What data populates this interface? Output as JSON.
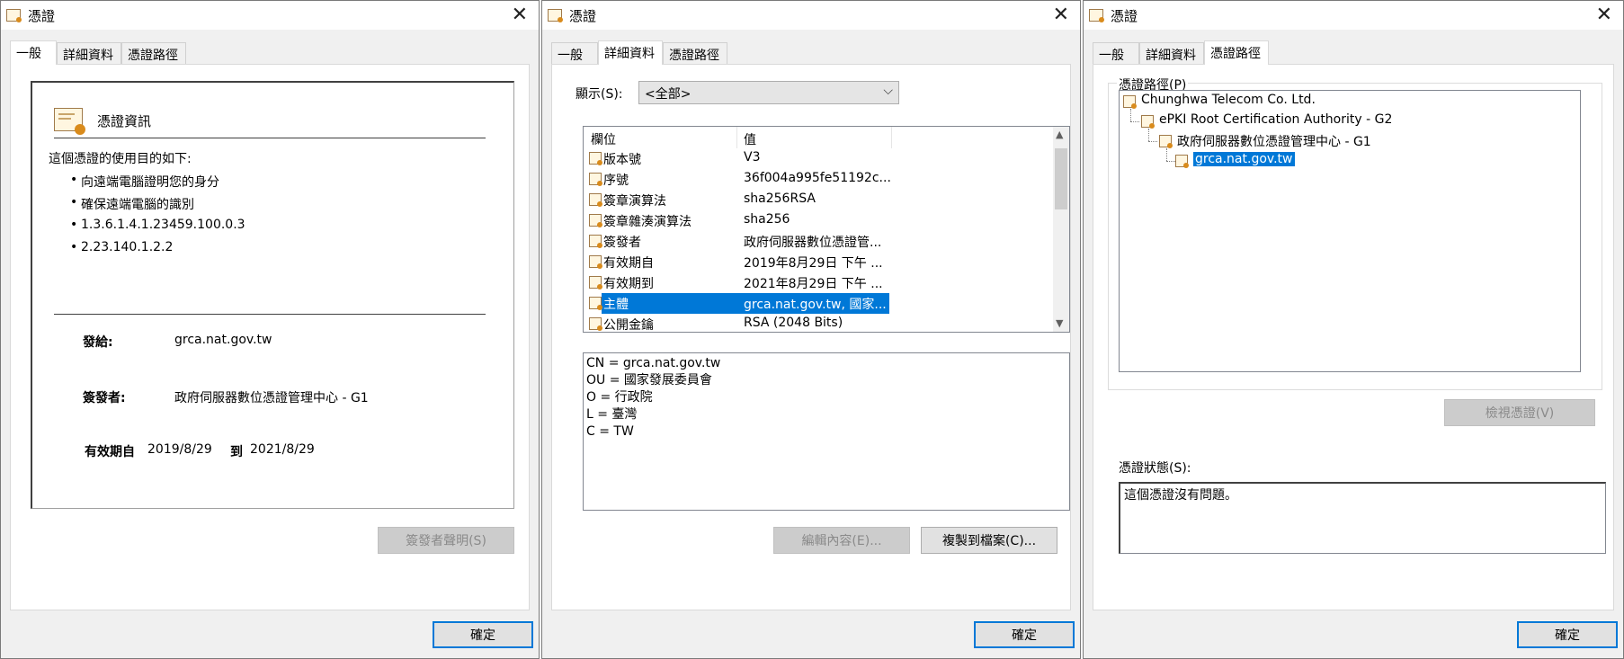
{
  "common": {
    "title": "憑證",
    "tabs": [
      "一般",
      "詳細資料",
      "憑證路徑"
    ],
    "ok_label": "確定",
    "close_glyph": "✕"
  },
  "general": {
    "section_title": "憑證資訊",
    "purpose_heading": "這個憑證的使用目的如下:",
    "purposes": [
      "向遠端電腦證明您的身分",
      "確保遠端電腦的識別",
      "1.3.6.1.4.1.23459.100.0.3",
      "2.23.140.1.2.2"
    ],
    "issued_to_label": "發給:",
    "issued_to_value": "grca.nat.gov.tw",
    "issuer_label": "簽發者:",
    "issuer_value": "政府伺服器數位憑證管理中心 - G1",
    "valid_from_label": "有效期自",
    "valid_from": "2019/8/29",
    "valid_to_label": "到",
    "valid_to": "2021/8/29",
    "issuer_statement_button": "簽發者聲明(S)"
  },
  "details": {
    "show_label": "顯示(S):",
    "show_value": "<全部>",
    "col_field": "欄位",
    "col_value": "值",
    "rows": [
      {
        "field": "版本號",
        "value": "V3"
      },
      {
        "field": "序號",
        "value": "36f004a995fe51192c..."
      },
      {
        "field": "簽章演算法",
        "value": "sha256RSA"
      },
      {
        "field": "簽章雜湊演算法",
        "value": "sha256"
      },
      {
        "field": "簽發者",
        "value": "政府伺服器數位憑證管..."
      },
      {
        "field": "有效期自",
        "value": "2019年8月29日 下午 ..."
      },
      {
        "field": "有效期到",
        "value": "2021年8月29日 下午 ..."
      },
      {
        "field": "主體",
        "value": "grca.nat.gov.tw, 國家..."
      },
      {
        "field": "公開金鑰",
        "value": "RSA (2048 Bits)"
      }
    ],
    "detail_lines": [
      "CN = grca.nat.gov.tw",
      "OU = 國家發展委員會",
      "O = 行政院",
      "L = 臺灣",
      "C = TW"
    ],
    "edit_button": "編輯內容(E)...",
    "copy_button": "複製到檔案(C)..."
  },
  "path": {
    "group_label": "憑證路徑(P)",
    "nodes": [
      "Chunghwa Telecom Co. Ltd.",
      "ePKI Root Certification Authority - G2",
      "政府伺服器數位憑證管理中心 - G1",
      "grca.nat.gov.tw"
    ],
    "view_button": "檢視憑證(V)",
    "status_label": "憑證狀態(S):",
    "status_text": "這個憑證沒有問題。"
  }
}
